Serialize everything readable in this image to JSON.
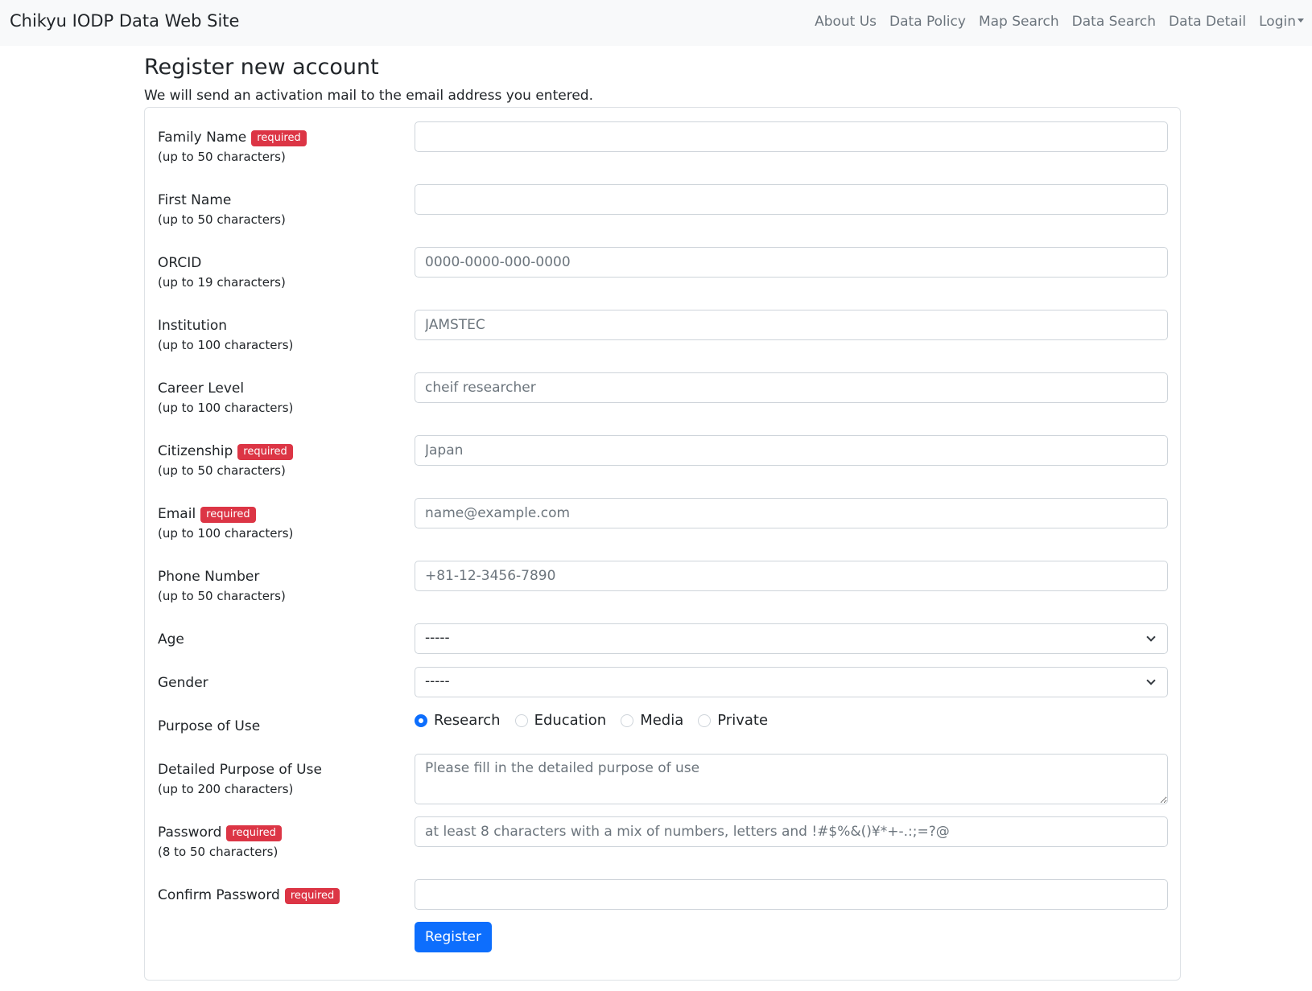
{
  "nav": {
    "brand": "Chikyu IODP Data Web Site",
    "links": [
      "About Us",
      "Data Policy",
      "Map Search",
      "Data Search",
      "Data Detail"
    ],
    "login": "Login"
  },
  "page": {
    "title": "Register new account",
    "intro": "We will send an activation mail to the email address you entered."
  },
  "form": {
    "required_badge": "required",
    "family_name": {
      "label": "Family Name",
      "hint": "(up to 50 characters)",
      "value": "",
      "placeholder": ""
    },
    "first_name": {
      "label": "First Name",
      "hint": "(up to 50 characters)",
      "value": "",
      "placeholder": ""
    },
    "orcid": {
      "label": "ORCID",
      "hint": "(up to 19 characters)",
      "placeholder": "0000-0000-000-0000"
    },
    "institution": {
      "label": "Institution",
      "hint": "(up to 100 characters)",
      "placeholder": "JAMSTEC"
    },
    "career_level": {
      "label": "Career Level",
      "hint": "(up to 100 characters)",
      "placeholder": "cheif researcher"
    },
    "citizenship": {
      "label": "Citizenship",
      "hint": "(up to 50 characters)",
      "placeholder": "Japan"
    },
    "email": {
      "label": "Email",
      "hint": "(up to 100 characters)",
      "placeholder": "name@example.com"
    },
    "phone": {
      "label": "Phone Number",
      "hint": "(up to 50 characters)",
      "placeholder": "+81-12-3456-7890"
    },
    "age": {
      "label": "Age",
      "selected": "-----"
    },
    "gender": {
      "label": "Gender",
      "selected": "-----"
    },
    "purpose": {
      "label": "Purpose of Use",
      "options": [
        "Research",
        "Education",
        "Media",
        "Private"
      ],
      "selected": "Research"
    },
    "detailed_purpose": {
      "label": "Detailed Purpose of Use",
      "hint": "(up to 200 characters)",
      "placeholder": "Please fill in the detailed purpose of use"
    },
    "password": {
      "label": "Password",
      "hint": "(8 to 50 characters)",
      "placeholder": "at least 8 characters with a mix of numbers, letters and !#$%&()¥*+-.:;=?@"
    },
    "confirm_password": {
      "label": "Confirm Password",
      "placeholder": ""
    },
    "submit_label": "Register"
  }
}
